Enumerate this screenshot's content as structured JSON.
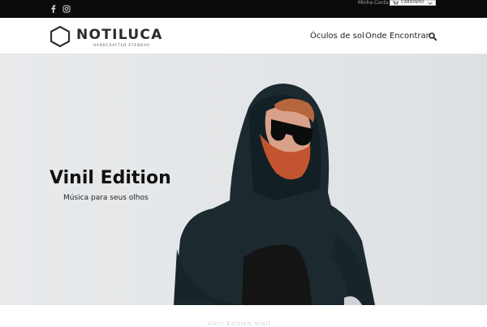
{
  "topbar": {
    "social": [
      {
        "icon": "facebook-icon"
      },
      {
        "icon": "instagram-icon"
      }
    ],
    "account_label": "Minha Conta",
    "cart_label": "CARRINHO"
  },
  "header": {
    "logo_word": "NOTILUCA",
    "logo_tagline": "HANDCRAFTED EYEWEAR",
    "nav": [
      {
        "label": "Óculos de sol"
      },
      {
        "label": "Onde Encontrar"
      }
    ]
  },
  "hero": {
    "title": "Vinil Edition",
    "subtitle": "Música para seus olhos"
  },
  "below": {
    "partial_text": "Vinil    Edition   Vinil"
  },
  "colors": {
    "topbar": "#0b0b0b",
    "hero_bg": "#e5e8ea",
    "hoodie": "#1c2a30",
    "beard": "#c2552f"
  }
}
